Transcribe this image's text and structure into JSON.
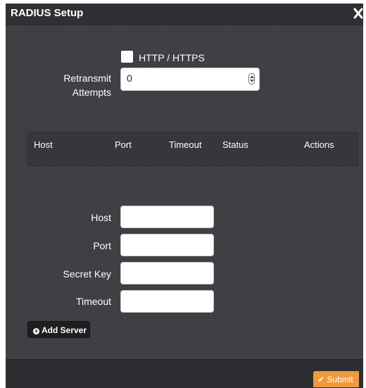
{
  "dialog": {
    "title": "RADIUS Setup",
    "close_glyph": "✕"
  },
  "protocol": {
    "checkbox_label": "HTTP / HTTPS",
    "checked": false
  },
  "retransmit": {
    "label_line1": "Retransmit",
    "label_line2": "Attempts",
    "value": "0"
  },
  "servers_table": {
    "headers": [
      "Host",
      "Port",
      "Timeout",
      "Status",
      "Actions"
    ],
    "rows": []
  },
  "form": {
    "host_label": "Host",
    "host_value": "",
    "port_label": "Port",
    "port_value": "",
    "secret_label": "Secret Key",
    "secret_value": "",
    "timeout_label": "Timeout",
    "timeout_value": ""
  },
  "buttons": {
    "add_server": "Add Server",
    "add_icon": "plus-circle-icon",
    "submit": "Submit",
    "submit_icon": "checkmark-icon"
  },
  "colors": {
    "dialog_bg": "#3e3f43",
    "titlebar_bg": "#2f3033",
    "submit_accent": "#ef9a3c"
  }
}
